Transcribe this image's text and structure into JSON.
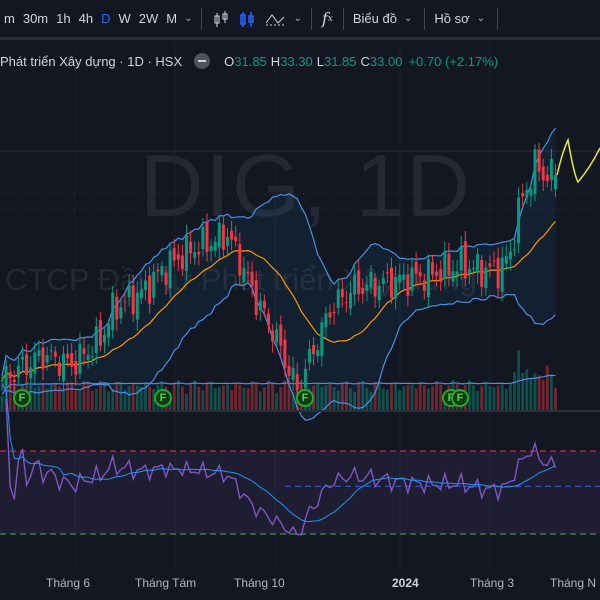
{
  "toolbar": {
    "timeframes": [
      "m",
      "30m",
      "1h",
      "4h",
      "D",
      "W",
      "2W",
      "M"
    ],
    "active_timeframe": "D",
    "chart_menu": "Biểu đồ",
    "profile_menu": "Hồ sơ",
    "icons": [
      "bar-style-icon",
      "candles-icon",
      "indicators-wave-icon",
      "function-fx-icon"
    ]
  },
  "legend": {
    "title": "Phát triển Xây dựng · 1D · HSX",
    "open_label": "O",
    "open": "31.85",
    "high_label": "H",
    "high": "33.30",
    "low_label": "L",
    "low": "31.85",
    "close_label": "C",
    "close": "33.00",
    "change": "+0.70 (+2.17%)"
  },
  "watermark": {
    "symbol": "DIG, 1D",
    "company": "CTCP Đầu tư Phát triển Xây dựng"
  },
  "time_axis": [
    "Tháng 6",
    "Tháng Tám",
    "Tháng 10",
    "2024",
    "Tháng 3",
    "Tháng N"
  ],
  "colors": {
    "up": "#089981",
    "down": "#f23645",
    "bb": "#4a90e2",
    "basis": "#ff9800",
    "rsi": "#7e57c2",
    "forecast": "#e6e63a",
    "accent": "#2962ff"
  },
  "events": [
    {
      "label": "F"
    },
    {
      "label": "F"
    },
    {
      "label": "F"
    },
    {
      "label": "F"
    },
    {
      "label": "F"
    }
  ],
  "chart_data": {
    "type": "candlestick",
    "symbol": "DIG",
    "interval": "1D",
    "last": {
      "open": 31.85,
      "high": 33.3,
      "low": 31.85,
      "close": 33.0
    },
    "close_keypoints": [
      [
        0,
        16.6
      ],
      [
        10,
        18.6
      ],
      [
        17,
        17.8
      ],
      [
        24,
        19.8
      ],
      [
        27,
        22.2
      ],
      [
        35,
        23.8
      ],
      [
        39,
        25.4
      ],
      [
        46,
        27
      ],
      [
        55,
        28.2
      ],
      [
        58,
        26.2
      ],
      [
        62,
        23
      ],
      [
        66,
        20.6
      ],
      [
        69,
        18.2
      ],
      [
        72,
        15.8
      ],
      [
        75,
        18.2
      ],
      [
        80,
        22.2
      ],
      [
        85,
        23.8
      ],
      [
        90,
        24.2
      ],
      [
        97,
        24.6
      ],
      [
        104,
        25
      ],
      [
        112,
        25.8
      ],
      [
        117,
        25.4
      ],
      [
        121,
        25.4
      ],
      [
        124,
        26.6
      ],
      [
        126,
        30.2
      ],
      [
        130,
        33.8
      ],
      [
        132,
        33
      ],
      [
        135,
        33
      ]
    ],
    "indicators": [
      "Bollinger Bands (20,2)",
      "Volume MA",
      "RSI (14)"
    ],
    "rsi_levels": [
      70,
      50,
      30
    ]
  }
}
